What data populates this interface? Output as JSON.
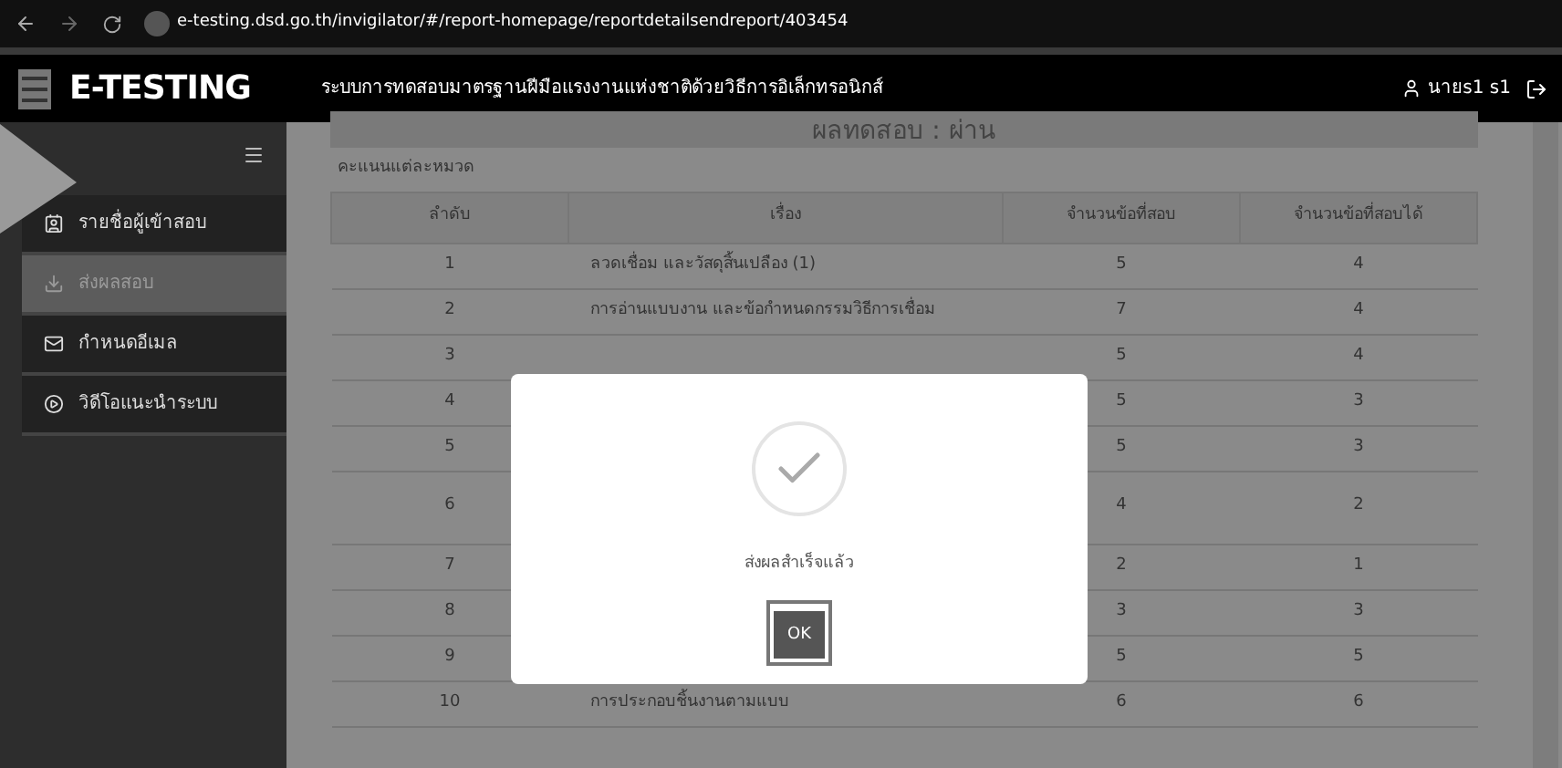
{
  "browser": {
    "url": "e-testing.dsd.go.th/invigilator/#/report-homepage/reportdetailsendreport/403454"
  },
  "header": {
    "logo": "E-TESTING",
    "title": "ระบบการทดสอบมาตรฐานฝีมือแรงงานแห่งชาติด้วยวิธีการอิเล็กทรอนิกส์",
    "user": "นายs1 s1"
  },
  "sidebar": {
    "items": [
      {
        "label": "รายชื่อผู้เข้าสอบ",
        "kind": "card",
        "selected": false
      },
      {
        "label": "ส่งผลสอบ",
        "kind": "download",
        "selected": true
      },
      {
        "label": "กำหนดอีเมล",
        "kind": "mail",
        "selected": false
      },
      {
        "label": "วิดีโอแนะนำระบบ",
        "kind": "play",
        "selected": false
      }
    ]
  },
  "result_title": "ผลทดสอบ : ผ่าน",
  "section_label": "คะแนนแต่ละหมวด",
  "table": {
    "columns": [
      "ลำดับ",
      "เรื่อง",
      "จำนวนข้อที่สอบ",
      "จำนวนข้อที่สอบได้"
    ],
    "rows": [
      [
        "1",
        "ลวดเชื่อม และวัสดุสิ้นเปลือง (1)",
        "5",
        "4"
      ],
      [
        "2",
        "การอ่านแบบงาน และข้อกำหนดกรรมวิธีการเชื่อม",
        "7",
        "4"
      ],
      [
        "3",
        "",
        "5",
        "4"
      ],
      [
        "4",
        "",
        "5",
        "3"
      ],
      [
        "5",
        "",
        "5",
        "3"
      ],
      [
        "6",
        "",
        "4",
        "2"
      ],
      [
        "7",
        "",
        "2",
        "1"
      ],
      [
        "8",
        "",
        "3",
        "3"
      ],
      [
        "9",
        "",
        "5",
        "5"
      ],
      [
        "10",
        "การประกอบชิ้นงานตามแบบ",
        "6",
        "6"
      ]
    ]
  },
  "dialog": {
    "message": "ส่งผลสำเร็จแล้ว",
    "button": "OK"
  }
}
